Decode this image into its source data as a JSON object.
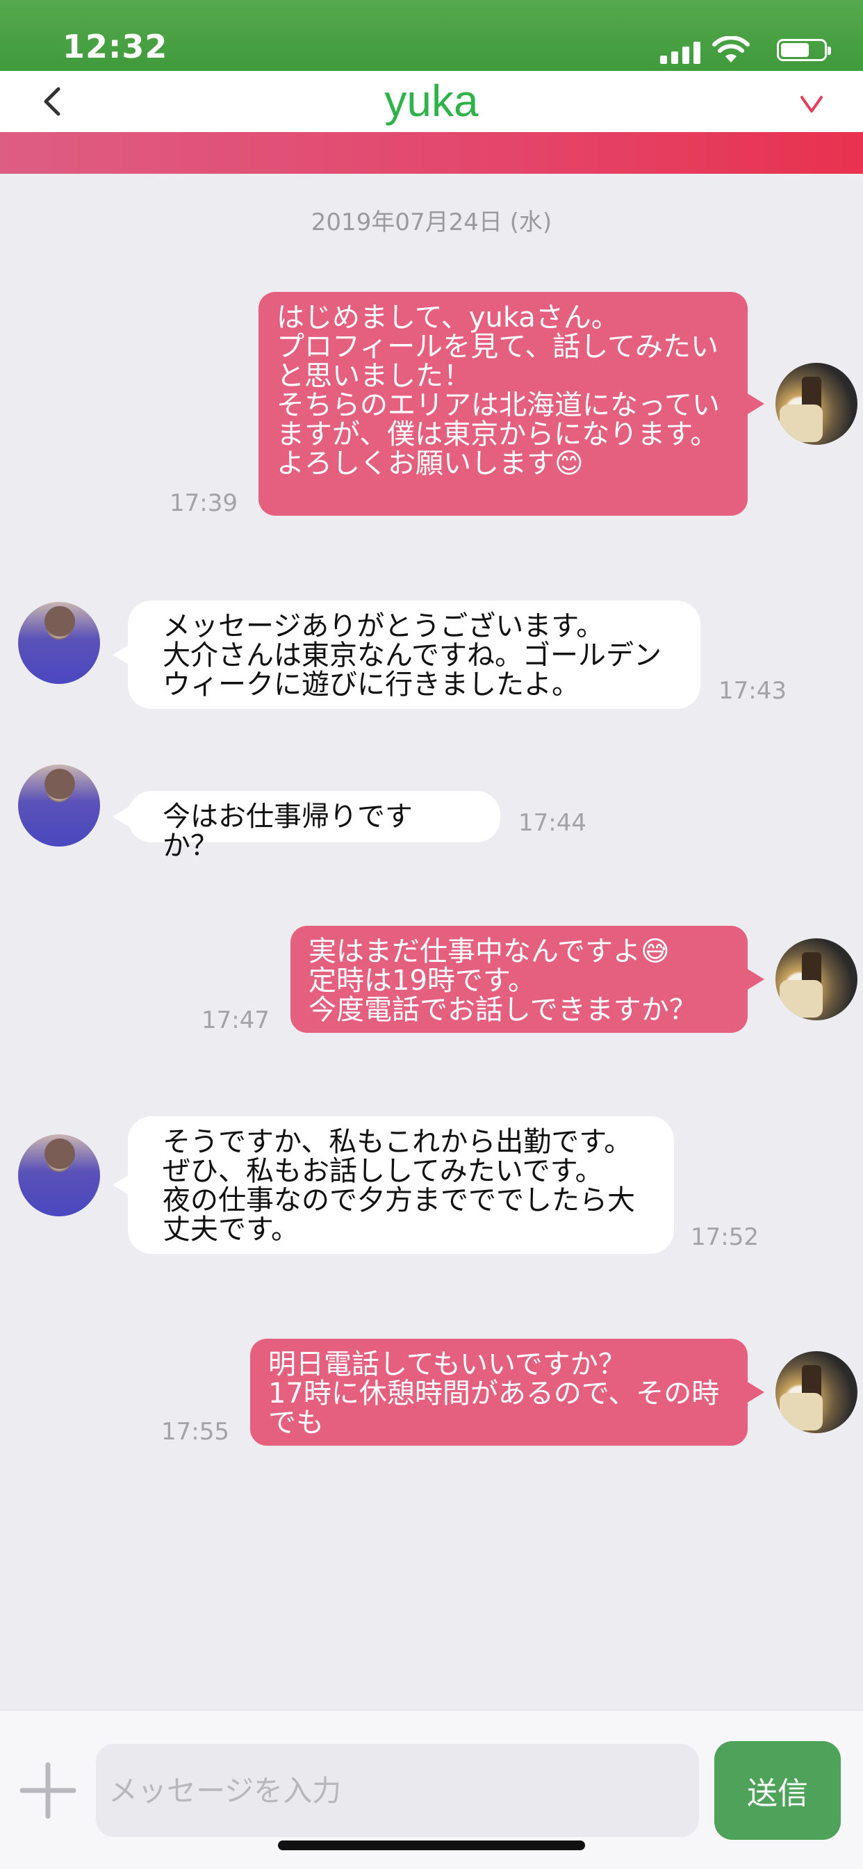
{
  "status": {
    "time": "12:32"
  },
  "header": {
    "title": "yuka"
  },
  "chat": {
    "date": "2019年07月24日 (水)",
    "messages": [
      {
        "side": "me",
        "time": "17:39",
        "text": "はじめまして、yukaさん。\nプロフィールを見て、話してみたいと思いました！\nそちらのエリアは北海道になっていますが、僕は東京からになります。\nよろしくお願いします😊"
      },
      {
        "side": "them",
        "time": "17:43",
        "text": "メッセージありがとうございます。\n大介さんは東京なんですね。ゴールデンウィークに遊びに行きましたよ。"
      },
      {
        "side": "them",
        "time": "17:44",
        "text": "今はお仕事帰りですか？"
      },
      {
        "side": "me",
        "time": "17:47",
        "text": "実はまだ仕事中なんですよ😅\n定時は19時です。\n今度電話でお話しできますか？"
      },
      {
        "side": "them",
        "time": "17:52",
        "text": "そうですか、私もこれから出勤です。\nぜひ、私もお話ししてみたいです。\n夜の仕事なので夕方までででしたら大丈夫です。"
      },
      {
        "side": "me",
        "time": "17:55",
        "text": "明日電話してもいいですか？\n17時に休憩時間があるので、その時でも"
      }
    ]
  },
  "composer": {
    "placeholder": "メッセージを入力",
    "send_label": "送信"
  },
  "colors": {
    "status_bar": "#4aa345",
    "title": "#2fb24a",
    "my_bubble": "#e4607e",
    "accent_band": "#e4456a",
    "send_button": "#4ea25a"
  }
}
